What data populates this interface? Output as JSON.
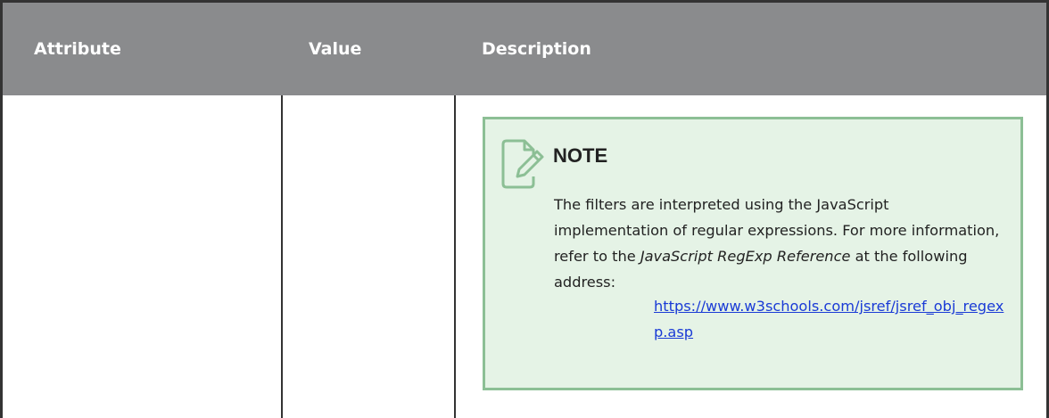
{
  "table": {
    "headers": [
      "Attribute",
      "Value",
      "Description"
    ]
  },
  "note": {
    "icon": "note-edit-icon",
    "title": "NOTE",
    "text_part1": "The filters are interpreted using the JavaScript implementation of regular expressions. For more information, refer to the ",
    "text_italic": "JavaScript RegExp Reference",
    "text_part2": " at the following address:",
    "link": "https://www.w3schools.com/jsref/jsref_obj_regexp.asp"
  },
  "colors": {
    "header_bg": "#8a8b8d",
    "note_bg": "#e5f3e6",
    "note_border": "#8cbf95",
    "link": "#1a3bd6"
  }
}
